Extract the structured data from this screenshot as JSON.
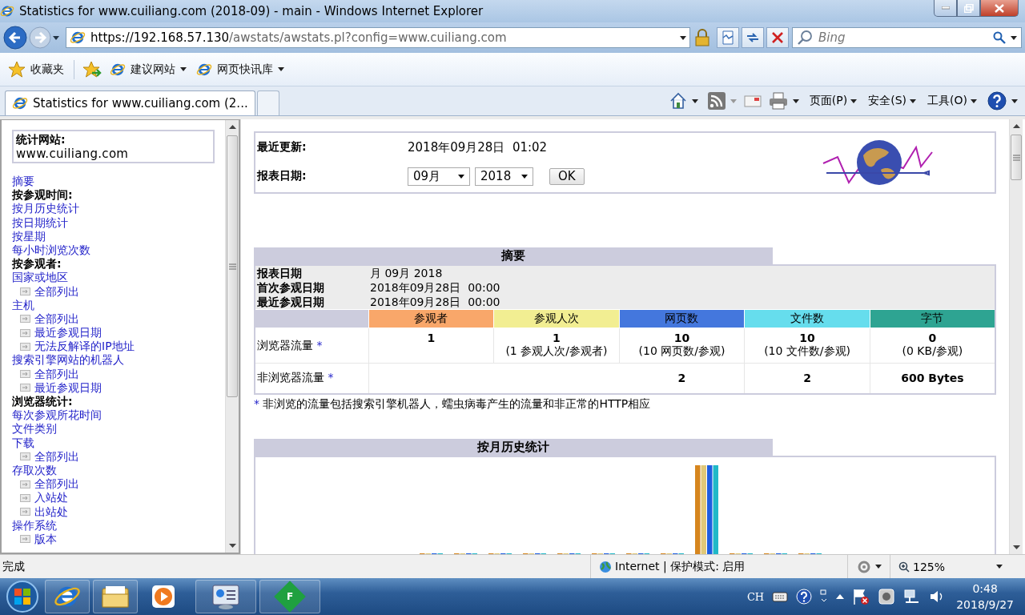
{
  "window": {
    "title": "Statistics for www.cuiliang.com (2018-09) - main - Windows Internet Explorer"
  },
  "address_bar": {
    "url_host": "https://192.168.57.130",
    "url_path": "/awstats/awstats.pl?config=www.cuiliang.com",
    "search_placeholder": "Bing"
  },
  "favorites_bar": {
    "favorites": "收藏夹",
    "links": [
      "建议网站",
      "网页快讯库"
    ]
  },
  "tabs": [
    {
      "label": "Statistics for www.cuiliang.com (2...",
      "selected": true
    }
  ],
  "command_bar": {
    "menus": [
      "页面(P)",
      "安全(S)",
      "工具(O)"
    ]
  },
  "sidebar": {
    "site_label": "统计网站:",
    "site": "www.cuiliang.com",
    "items": [
      {
        "kind": "link",
        "label": "摘要"
      },
      {
        "kind": "heading",
        "label": "按参观时间:"
      },
      {
        "kind": "link",
        "label": "按月历史统计"
      },
      {
        "kind": "link",
        "label": "按日期统计"
      },
      {
        "kind": "link",
        "label": "按星期"
      },
      {
        "kind": "link",
        "label": "每小时浏览次数"
      },
      {
        "kind": "heading",
        "label": "按参观者:"
      },
      {
        "kind": "link",
        "label": "国家或地区"
      },
      {
        "kind": "sublink",
        "label": "全部列出"
      },
      {
        "kind": "link",
        "label": "主机"
      },
      {
        "kind": "sublink",
        "label": "全部列出"
      },
      {
        "kind": "sublink",
        "label": "最近参观日期"
      },
      {
        "kind": "sublink",
        "label": "无法反解译的IP地址"
      },
      {
        "kind": "link",
        "label": "搜索引擎网站的机器人"
      },
      {
        "kind": "sublink",
        "label": "全部列出"
      },
      {
        "kind": "sublink",
        "label": "最近参观日期"
      },
      {
        "kind": "heading",
        "label": "浏览器统计:"
      },
      {
        "kind": "link",
        "label": "每次参观所花时间"
      },
      {
        "kind": "link",
        "label": "文件类别"
      },
      {
        "kind": "link",
        "label": "下载"
      },
      {
        "kind": "sublink",
        "label": "全部列出"
      },
      {
        "kind": "link",
        "label": "存取次数"
      },
      {
        "kind": "sublink",
        "label": "全部列出"
      },
      {
        "kind": "sublink",
        "label": "入站处"
      },
      {
        "kind": "sublink",
        "label": "出站处"
      },
      {
        "kind": "link",
        "label": "操作系统"
      },
      {
        "kind": "sublink",
        "label": "版本"
      }
    ]
  },
  "report_header": {
    "updated_label": "最近更新:",
    "updated_value": "2018年09月28日  01:02",
    "date_label": "报表日期:",
    "month": "09月",
    "year": "2018",
    "ok": "OK"
  },
  "summary": {
    "title": "摘要",
    "info": [
      {
        "label": "报表日期",
        "value": "月 09月 2018"
      },
      {
        "label": "首次参观日期",
        "value": "2018年09月28日  00:00"
      },
      {
        "label": "最近参观日期",
        "value": "2018年09月28日  00:00"
      }
    ],
    "columns": [
      {
        "label": "参观者",
        "color": "#f9a76a"
      },
      {
        "label": "参观人次",
        "color": "#f2ee92"
      },
      {
        "label": "网页数",
        "color": "#4477dd"
      },
      {
        "label": "文件数",
        "color": "#66dded"
      },
      {
        "label": "字节",
        "color": "#2ea492"
      }
    ],
    "rows": [
      {
        "kind": "browser",
        "label": "浏览器流量",
        "mark": "*",
        "cells": [
          {
            "main": "1"
          },
          {
            "main": "1",
            "sub": "(1 参观人次/参观者)"
          },
          {
            "main": "10",
            "sub": "(10 网页数/参观)"
          },
          {
            "main": "10",
            "sub": "(10 文件数/参观)"
          },
          {
            "main": "0",
            "sub": "(0 KB/参观)"
          }
        ]
      },
      {
        "kind": "non_browser",
        "label": "非浏览器流量",
        "mark": "*",
        "cells": [
          {},
          {},
          {
            "main": "2"
          },
          {
            "main": "2"
          },
          {
            "main": "600 Bytes"
          }
        ]
      }
    ],
    "footnote": {
      "mark": "*",
      "text": "非浏览的流量包括搜索引擎机器人，蠕虫病毒产生的流量和非正常的HTTP相应"
    }
  },
  "monthly": {
    "title": "按月历史统计"
  },
  "status_bar": {
    "text": "完成",
    "zone": "Internet | 保护模式: 启用",
    "zoom": "125%"
  },
  "taskbar": {
    "app_badge": "F",
    "lang": "CH",
    "time": "0:48",
    "date": "2018/9/27"
  }
}
